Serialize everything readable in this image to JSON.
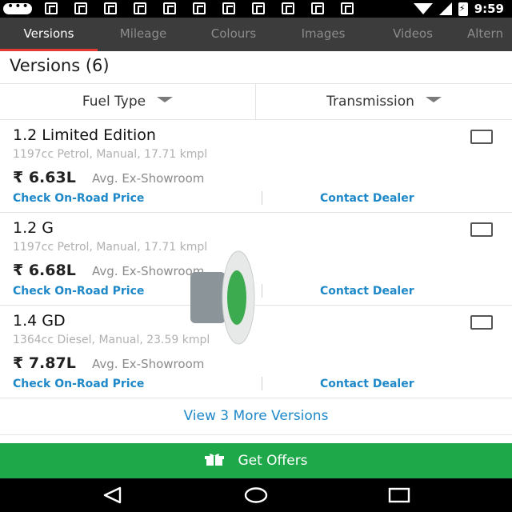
{
  "status_bar": {
    "time": "9:59",
    "icons": [
      "message-icon",
      "app-icon",
      "app-icon",
      "app-icon",
      "app-icon",
      "app-icon",
      "app-icon",
      "app-icon",
      "app-icon",
      "app-icon",
      "app-icon",
      "wifi-icon",
      "signal-icon",
      "battery-charging-icon"
    ]
  },
  "tabs": [
    {
      "label": "Versions",
      "active": true
    },
    {
      "label": "Mileage",
      "active": false
    },
    {
      "label": "Colours",
      "active": false
    },
    {
      "label": "Images",
      "active": false
    },
    {
      "label": "Videos",
      "active": false
    },
    {
      "label": "Altern",
      "active": false
    }
  ],
  "section_title": "Versions (6)",
  "filters": {
    "fuel_type": "Fuel Type",
    "transmission": "Transmission"
  },
  "versions": [
    {
      "name": "1.2 Limited Edition",
      "specs": "1197cc Petrol, Manual, 17.71 kmpl",
      "price": "₹ 6.63L",
      "price_note": "Avg. Ex-Showroom",
      "on_road_link": "Check On-Road Price",
      "dealer_link": "Contact Dealer"
    },
    {
      "name": "1.2 G",
      "specs": "1197cc Petrol, Manual, 17.71 kmpl",
      "price": "₹ 6.68L",
      "price_note": "Avg. Ex-Showroom",
      "on_road_link": "Check On-Road Price",
      "dealer_link": "Contact Dealer"
    },
    {
      "name": "1.4 GD",
      "specs": "1364cc Diesel, Manual, 23.59 kmpl",
      "price": "₹ 7.87L",
      "price_note": "Avg. Ex-Showroom",
      "on_road_link": "Check On-Road Price",
      "dealer_link": "Contact Dealer"
    }
  ],
  "more_versions": "View 3 More Versions",
  "offers_button": "Get Offers",
  "colors": {
    "tab_bar": "#3c3c3c",
    "tab_indicator": "#e53935",
    "link": "#1e88c8",
    "offers_green": "#1fa84a"
  }
}
